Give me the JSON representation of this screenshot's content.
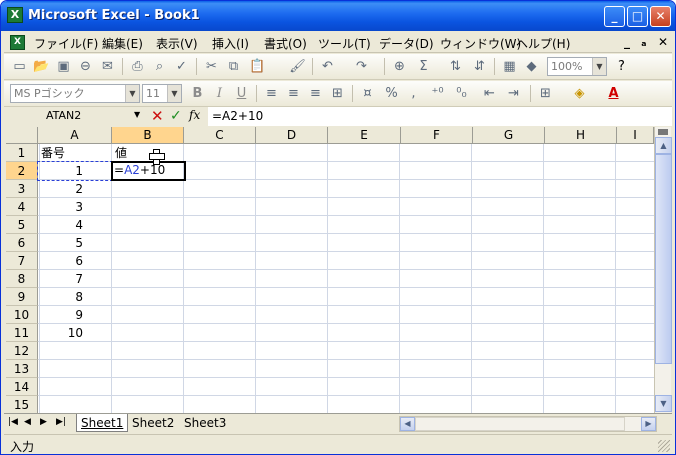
{
  "window": {
    "title": "Microsoft Excel - Book1",
    "app_icon": "X"
  },
  "window_buttons": {
    "minimize": "_",
    "maximize": "□",
    "close": "✕"
  },
  "menu": {
    "items": [
      "ファイル(F)",
      "編集(E)",
      "表示(V)",
      "挿入(I)",
      "書式(O)",
      "ツール(T)",
      "データ(D)",
      "ウィンドウ(W)",
      "ヘルプ(H)"
    ],
    "doc_controls": [
      "_",
      "ₐ",
      "✕"
    ]
  },
  "toolbar1": {
    "zoom": "100%",
    "sigma": "Σ"
  },
  "toolbar2": {
    "font_name": "MS Pゴシック",
    "font_size": "11",
    "bold": "B",
    "italic": "I",
    "underline": "U",
    "percent": "%",
    "comma": ","
  },
  "formula_bar": {
    "name_box": "ATAN2",
    "cancel": "✕",
    "enter": "✓",
    "fx": "fx",
    "content": "=A2+10"
  },
  "columns": [
    "A",
    "B",
    "C",
    "D",
    "E",
    "F",
    "G",
    "H",
    "I"
  ],
  "rows": [
    "1",
    "2",
    "3",
    "4",
    "5",
    "6",
    "7",
    "8",
    "9",
    "10",
    "11",
    "12",
    "13",
    "14",
    "15"
  ],
  "cells": {
    "A1": "番号",
    "B1": "値",
    "A2": "1",
    "A3": "2",
    "A4": "3",
    "A5": "4",
    "A6": "5",
    "A7": "6",
    "A8": "7",
    "A9": "8",
    "A10": "9",
    "A11": "10",
    "B2_prefix": "=",
    "B2_ref": "A2",
    "B2_suffix": "+10"
  },
  "sheets": [
    "Sheet1",
    "Sheet2",
    "Sheet3"
  ],
  "status": {
    "mode": "入力"
  }
}
